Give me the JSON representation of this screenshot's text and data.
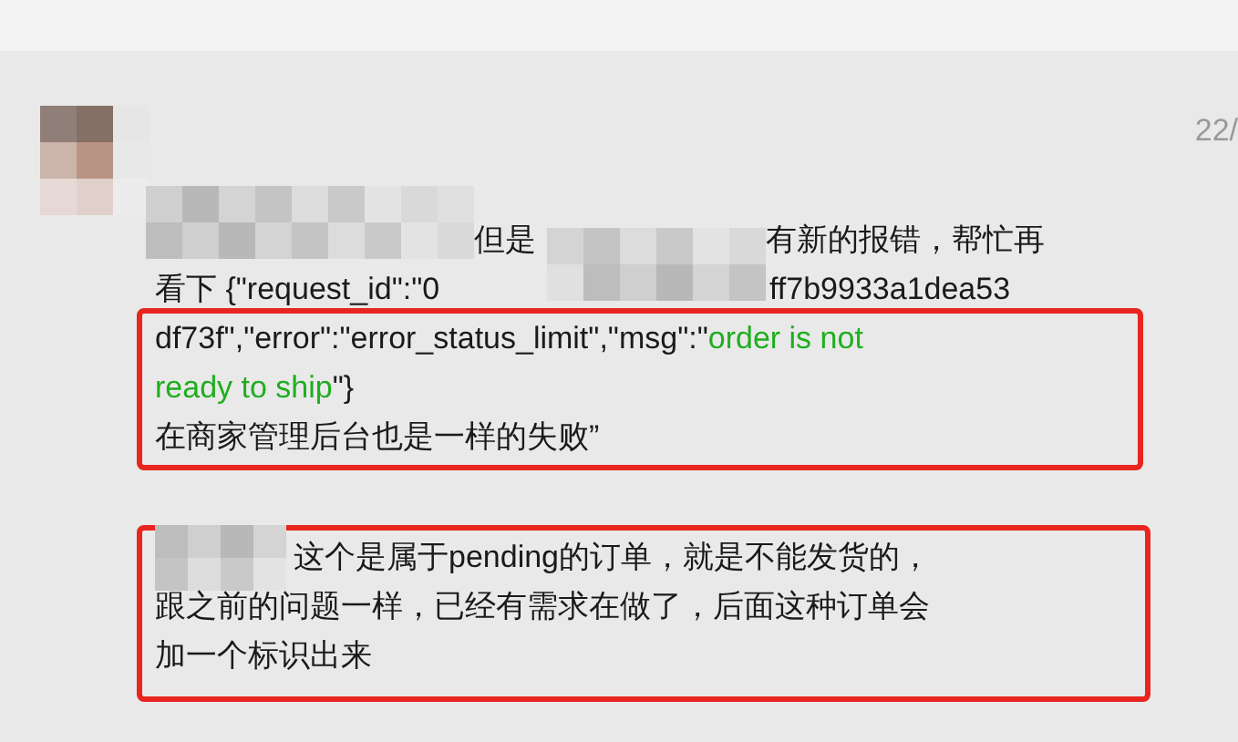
{
  "timestamp": "22/",
  "message_1": {
    "line_1": [
      "但是",
      "有新的报错，帮忙再"
    ],
    "line_2": [
      "看下 {\"request_id\":\"0",
      "ff7b9933a1dea53"
    ],
    "highlighted_lines": [
      [
        {
          "text": "df73f\",\"error\":\"error_status_limit\",\"msg\":\"",
          "kind": "plain"
        },
        {
          "text": "order is not",
          "kind": "value"
        }
      ],
      [
        {
          "text": "ready to ship",
          "kind": "value"
        },
        {
          "text": "\"}",
          "kind": "plain"
        }
      ],
      [
        {
          "text": "在商家管理后台也是一样的失败”",
          "kind": "plain"
        }
      ]
    ]
  },
  "message_2": {
    "lines": [
      "这个是属于pending的订单，就是不能发货的，",
      "跟之前的问题一样，已经有需求在做了，后面这种订单会",
      "加一个标识出来"
    ]
  }
}
